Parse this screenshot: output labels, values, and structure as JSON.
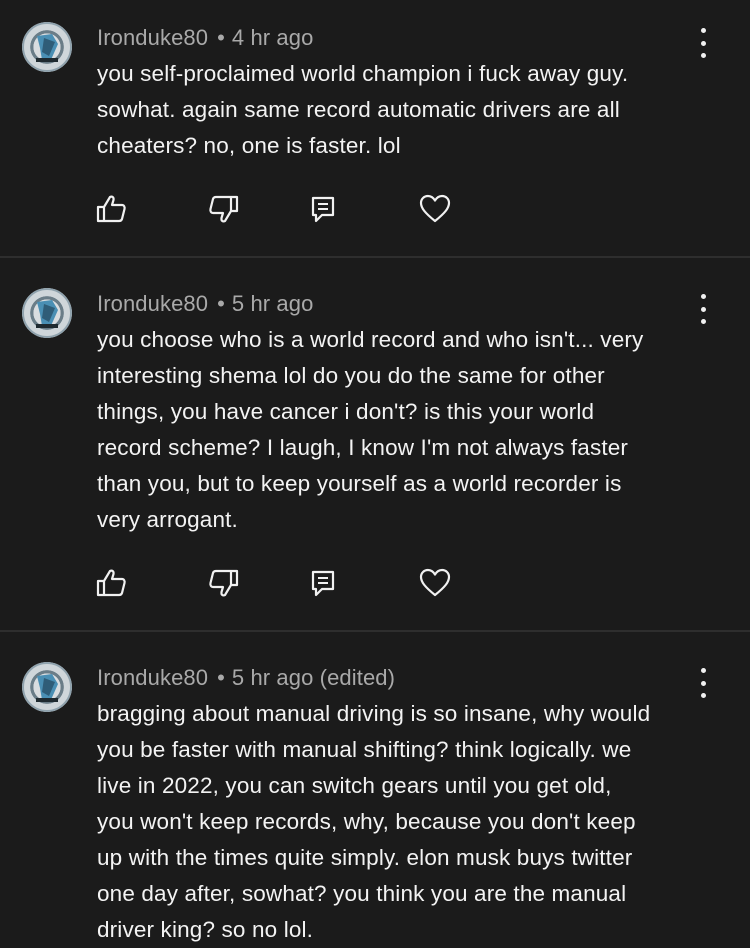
{
  "comments": [
    {
      "author": "Ironduke80",
      "separator": "•",
      "time": "4 hr ago",
      "lines": [
        "you self-proclaimed world champion i fuck away guy.",
        "sowhat. again same record automatic drivers are all",
        "cheaters? no, one is faster. lol"
      ]
    },
    {
      "author": "Ironduke80",
      "separator": "•",
      "time": "5 hr ago",
      "lines": [
        "you choose who is a world record and who isn't... very",
        "interesting shema lol do you do the same for other",
        "things, you have cancer i don't? is this your world",
        "record scheme? I laugh, I know I'm not always faster",
        "than you, but to keep yourself as a world recorder is",
        "very arrogant."
      ]
    },
    {
      "author": "Ironduke80",
      "separator": "•",
      "time": "5 hr ago (edited)",
      "lines": [
        "bragging about manual driving is so insane, why would",
        "you be faster with manual shifting? think logically. we",
        "live in 2022, you can switch gears until you get old,",
        "you won't keep records, why, because you don't keep",
        "up with the times quite simply. elon musk buys twitter",
        "one day after, sowhat? you think you are the manual",
        "driver king? so no lol."
      ]
    }
  ],
  "icons": {
    "like": "thumbs-up-icon",
    "dislike": "thumbs-down-icon",
    "reply": "reply-icon",
    "heart": "heart-icon",
    "more": "more-vertical-icon"
  },
  "colors": {
    "background": "#1b1b1b",
    "meta_text": "#a9a9a9",
    "body_text": "#f3f3f3",
    "divider": "#2e2e2e"
  }
}
